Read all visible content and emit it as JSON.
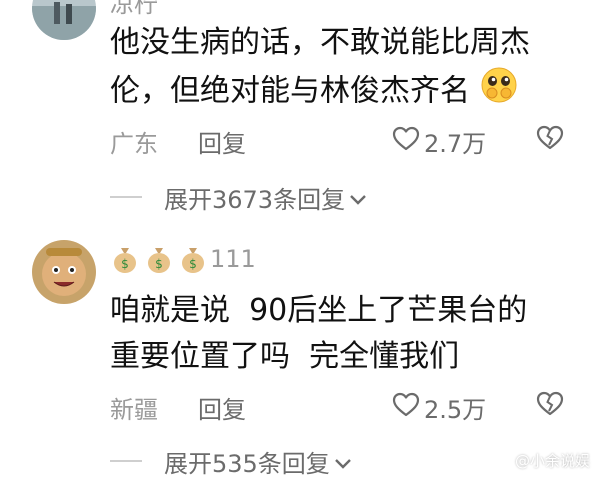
{
  "comments": [
    {
      "username": "凉柠",
      "content_line1": "他没生病的话，不敢说能比周杰",
      "content_line2": "伦，但绝对能与林俊杰齐名",
      "content_emoji": "pleading-hands-emoji",
      "location": "广东",
      "reply_label": "回复",
      "likes": "2.7万",
      "expand_label": "展开3673条回复"
    },
    {
      "username_emoji": "money-bag-emoji",
      "username_suffix": "111",
      "content_line1": "咱就是说  90后坐上了芒果台的",
      "content_line2": "重要位置了吗  完全懂我们",
      "location": "新疆",
      "reply_label": "回复",
      "likes": "2.5万",
      "expand_label": "展开535条回复"
    }
  ],
  "watermark": "@小余说娱",
  "colors": {
    "meta_gray": "#9a9a9a",
    "action_gray": "#6b6b6b",
    "text": "#111111"
  }
}
